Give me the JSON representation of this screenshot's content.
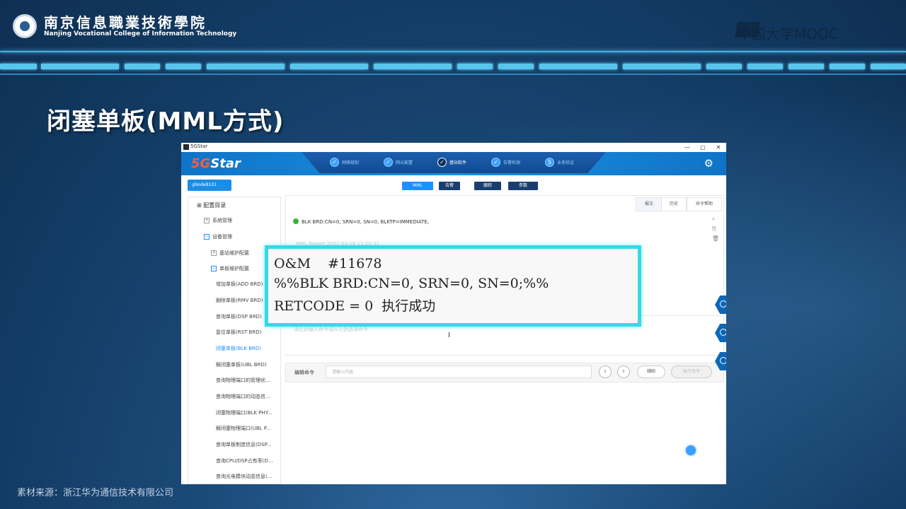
{
  "header": {
    "school_cn": "南京信息職業技術學院",
    "school_en": "Nanjing Vocational College of Information Technology",
    "platform": "中国大学MOOC"
  },
  "slide": {
    "title": "闭塞单板(MML方式)",
    "source": "素材来源：浙江华为通信技术有限公司"
  },
  "app": {
    "window_title": "5GStar",
    "window_controls": [
      "—",
      "▢",
      "✕"
    ],
    "brand_prefix": "5G",
    "brand_suffix": "Star",
    "wizard_steps": [
      {
        "label": "网络规划",
        "active": false,
        "glyph": "✓"
      },
      {
        "label": "网元配置",
        "active": false,
        "glyph": "✓"
      },
      {
        "label": "基站软件",
        "active": true,
        "glyph": "✓"
      },
      {
        "label": "告警检测",
        "active": false,
        "glyph": "✓"
      },
      {
        "label": "业务验证",
        "active": false,
        "glyph": "5"
      }
    ],
    "gear_icon": "⚙",
    "node_button": "gNodeB101",
    "tabs": [
      {
        "label": "MML",
        "active": true
      },
      {
        "label": "告警",
        "active": false
      },
      {
        "label": "跟踪",
        "active": false
      },
      {
        "label": "参数",
        "active": false
      }
    ],
    "sidebar": {
      "root": "配置目录",
      "items": [
        {
          "label": "系统管理",
          "box": "+",
          "level": 1
        },
        {
          "label": "设备管理",
          "box": "−",
          "level": 1
        },
        {
          "label": "基站维护配置",
          "box": "+",
          "level": 2
        },
        {
          "label": "单板维护配置",
          "box": "−",
          "level": 2
        },
        {
          "label": "增加单板(ADD BRD)",
          "box": "",
          "level": 3
        },
        {
          "label": "删除单板(RMV BRD)",
          "box": "",
          "level": 3
        },
        {
          "label": "查询单板(DSP BRD)",
          "box": "",
          "level": 3
        },
        {
          "label": "复位单板(RST BRD)",
          "box": "",
          "level": 3
        },
        {
          "label": "闭塞单板(BLK BRD)",
          "box": "",
          "level": 3,
          "selected": true
        },
        {
          "label": "解闭塞单板(UBL BRD)",
          "box": "",
          "level": 3
        },
        {
          "label": "查询物理端口的管理状...",
          "box": "",
          "level": 3
        },
        {
          "label": "查询物理端口的动态信...",
          "box": "",
          "level": 3
        },
        {
          "label": "闭塞物理端口(BLK PHY...",
          "box": "",
          "level": 3
        },
        {
          "label": "解闭塞物理端口(UBL P...",
          "box": "",
          "level": 3
        },
        {
          "label": "查询单板制造信息(DSP...",
          "box": "",
          "level": 3
        },
        {
          "label": "查询CPU/DSP占有率(D...",
          "box": "",
          "level": 3
        },
        {
          "label": "查询光电模块动态信息(...",
          "box": "",
          "level": 3
        }
      ]
    },
    "panel_tabs": [
      "报文",
      "历史",
      "命令帮助"
    ],
    "result": "BLK BRD:CN=0, SRN=0, SN=0, BLKTP=IMMEDIATE;",
    "faint_time": "MML Report   2022-03-08 11:20:31",
    "side_icons": [
      "⌕",
      "⎘",
      "🗑"
    ],
    "input_hint": "请在此输入命令或从左侧选择命令",
    "cmd_label": "编辑命令",
    "cmd_placeholder": "请输入内容",
    "nav_prev": "‹",
    "nav_next": "›",
    "assist_button": "辅助",
    "execute_button": "执行命令"
  },
  "overlay": {
    "line1": "O&M    #11678",
    "line2": "%%BLK BRD:CN=0, SRN=0, SN=0;%%",
    "line3": "RETCODE = 0  执行成功"
  }
}
